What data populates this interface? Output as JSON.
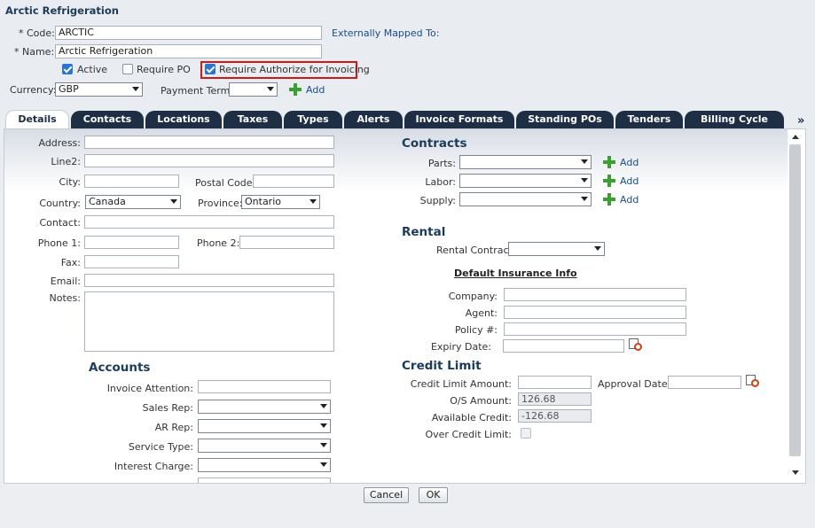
{
  "header": {
    "title": "Arctic Refrigeration"
  },
  "top_form": {
    "code_label": "* Code:",
    "code_value": "ARCTIC",
    "externally_mapped": "Externally Mapped To:",
    "name_label": "* Name:",
    "name_value": "Arctic Refrigeration",
    "active_label": "Active",
    "require_po_label": "Require PO",
    "require_auth_label": "Require Authorize for Invoicing",
    "currency_label": "Currency:",
    "currency_value": "GBP",
    "payment_term_label": "Payment Term:",
    "payment_term_value": "",
    "add_label": "Add"
  },
  "tabs": [
    "Details",
    "Contacts",
    "Locations",
    "Taxes",
    "Types",
    "Alerts",
    "Invoice Formats",
    "Standing POs",
    "Tenders",
    "Billing Cycle"
  ],
  "more_tabs": "»",
  "details": {
    "address_label": "Address:",
    "line2_label": "Line2:",
    "city_label": "City:",
    "postal_label": "Postal Code:",
    "country_label": "Country:",
    "country_value": "Canada",
    "province_label": "Province:",
    "province_value": "Ontario",
    "contact_label": "Contact:",
    "phone1_label": "Phone 1:",
    "phone2_label": "Phone 2:",
    "fax_label": "Fax:",
    "email_label": "Email:",
    "notes_label": "Notes:"
  },
  "accounts": {
    "heading": "Accounts",
    "invoice_attention": "Invoice Attention:",
    "sales_rep": "Sales Rep:",
    "ar_rep": "AR Rep:",
    "service_type": "Service Type:",
    "interest_charge": "Interest Charge:"
  },
  "contracts": {
    "heading": "Contracts",
    "parts": "Parts:",
    "labor": "Labor:",
    "supply": "Supply:",
    "add": "Add"
  },
  "rental": {
    "heading": "Rental",
    "rental_contract": "Rental Contract",
    "insurance_heading": "Default Insurance Info",
    "company": "Company:",
    "agent": "Agent:",
    "policy": "Policy #:",
    "expiry": "Expiry Date:"
  },
  "credit": {
    "heading": "Credit Limit",
    "limit_amount": "Credit Limit Amount:",
    "approval_date": "Approval Date:",
    "os_amount": "O/S Amount:",
    "os_value": "126.68",
    "available": "Available Credit:",
    "available_value": "-126.68",
    "over_limit": "Over Credit Limit:"
  },
  "footer": {
    "cancel": "Cancel",
    "ok": "OK"
  },
  "colors": {
    "accent": "#1c3b5a",
    "tab_bg": "#1e2e44",
    "highlight": "#d01818",
    "add_green": "#3aa032"
  },
  "icons": [
    "add-plus-icon",
    "calendar-icon",
    "dropdown-arrow-icon",
    "checkbox-icon"
  ]
}
